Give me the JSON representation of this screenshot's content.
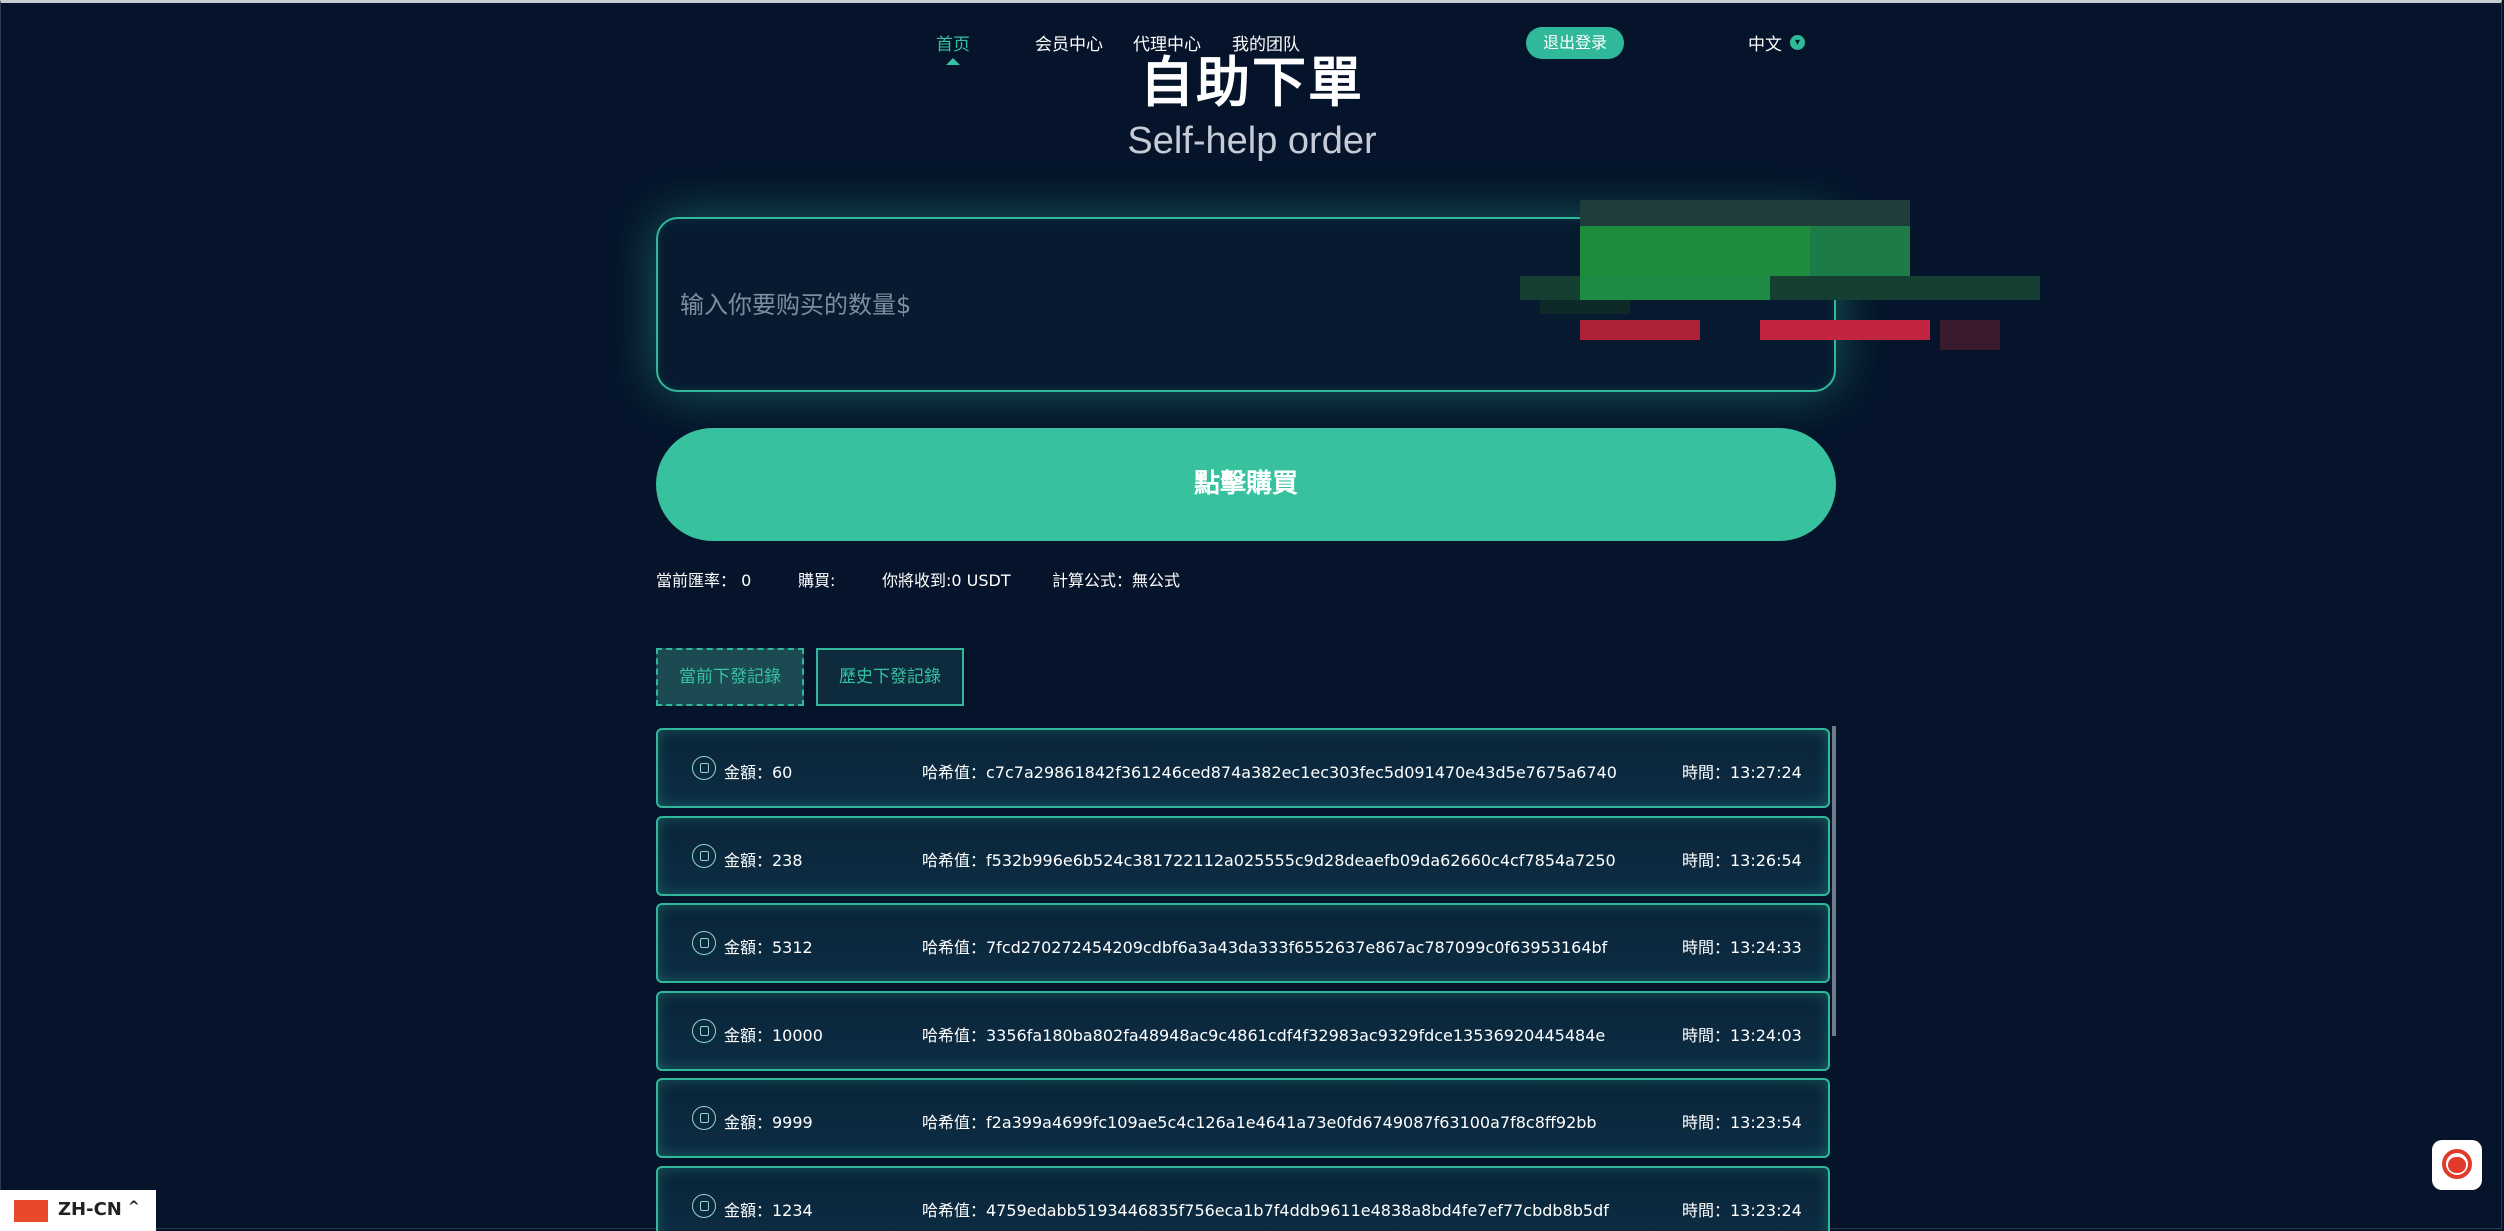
{
  "nav": {
    "items": [
      {
        "label": "首页",
        "active": true
      },
      {
        "label": "会员中心",
        "active": false
      },
      {
        "label": "代理中心",
        "active": false
      },
      {
        "label": "我的团队",
        "active": false
      }
    ],
    "logout_label": "退出登录",
    "language_label": "中文",
    "language_icon": "chevron-down-icon"
  },
  "hero": {
    "title_cn": "自助下單",
    "title_en": "Self-help order"
  },
  "order": {
    "quantity_placeholder": "输入你要购买的数量$",
    "buy_label": "點擊購買"
  },
  "info": {
    "rate": "當前匯率： 0",
    "buy": "購買:",
    "receive": "你將收到:0 USDT",
    "formula": "計算公式：無公式"
  },
  "tabs": [
    {
      "label": "當前下發記錄",
      "active": true
    },
    {
      "label": "歷史下發記錄",
      "active": false
    }
  ],
  "records": [
    {
      "amount": "金額：60",
      "hash": "哈希值：c7c7a29861842f361246ced874a382ec1ec303fec5d091470e43d5e7675a6740",
      "time": "時間：13:27:24"
    },
    {
      "amount": "金額：238",
      "hash": "哈希值：f532b996e6b524c381722112a025555c9d28deaefb09da62660c4cf7854a7250",
      "time": "時間：13:26:54"
    },
    {
      "amount": "金額：5312",
      "hash": "哈希值：7fcd270272454209cdbf6a3a43da333f6552637e867ac787099c0f63953164bf",
      "time": "時間：13:24:33"
    },
    {
      "amount": "金額：10000",
      "hash": "哈希值：3356fa180ba802fa48948ac9c4861cdf4f32983ac9329fdce13536920445484e",
      "time": "時間：13:24:03"
    },
    {
      "amount": "金額：9999",
      "hash": "哈希值：f2a399a4699fc109ae5c4c126a1e4641a73e0fd6749087f63100a7f8c8ff92bb",
      "time": "時間：13:23:54"
    },
    {
      "amount": "金額：1234",
      "hash": "哈希值：4759edabb5193446835f756eca1b7f4ddb9611e4838a8bd4fe7ef77cbdb8b5df",
      "time": "時間：13:23:24"
    }
  ],
  "language_switcher": {
    "label": "ZH-CN",
    "icon": "chevron-up-icon"
  },
  "colors": {
    "accent": "#2fb899",
    "background": "#05142a"
  }
}
